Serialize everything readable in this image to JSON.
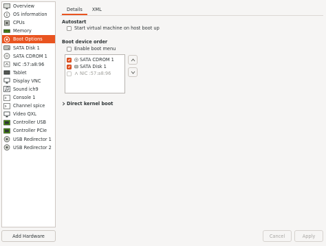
{
  "sidebar": {
    "items": [
      {
        "label": "Overview",
        "icon": "monitor-icon"
      },
      {
        "label": "OS information",
        "icon": "info-icon"
      },
      {
        "label": "CPUs",
        "icon": "cpu-icon"
      },
      {
        "label": "Memory",
        "icon": "memory-icon"
      },
      {
        "label": "Boot Options",
        "icon": "boot-gear-icon"
      },
      {
        "label": "SATA Disk 1",
        "icon": "disk-icon"
      },
      {
        "label": "SATA CDROM 1",
        "icon": "cdrom-icon"
      },
      {
        "label": "NIC :57:a8:96",
        "icon": "nic-icon"
      },
      {
        "label": "Tablet",
        "icon": "tablet-icon"
      },
      {
        "label": "Display VNC",
        "icon": "display-icon"
      },
      {
        "label": "Sound ich9",
        "icon": "sound-icon"
      },
      {
        "label": "Console 1",
        "icon": "console-icon"
      },
      {
        "label": "Channel spice",
        "icon": "channel-icon"
      },
      {
        "label": "Video QXL",
        "icon": "video-icon"
      },
      {
        "label": "Controller USB",
        "icon": "controller-icon"
      },
      {
        "label": "Controller PCIe",
        "icon": "controller-icon"
      },
      {
        "label": "USB Redirector 1",
        "icon": "usb-redirector-icon"
      },
      {
        "label": "USB Redirector 2",
        "icon": "usb-redirector-icon"
      }
    ],
    "selected_index": 4,
    "add_hardware_label": "Add Hardware"
  },
  "tabs": [
    {
      "label": "Details",
      "active": true
    },
    {
      "label": "XML",
      "active": false
    }
  ],
  "autostart": {
    "heading": "Autostart",
    "checkbox_label": "Start virtual machine on host boot up",
    "checked": false
  },
  "boot_order": {
    "heading": "Boot device order",
    "enable_menu_label": "Enable boot menu",
    "enable_menu_checked": false,
    "devices": [
      {
        "label": "SATA CDROM 1",
        "checked": true,
        "enabled": true,
        "icon": "cdrom-icon"
      },
      {
        "label": "SATA Disk 1",
        "checked": true,
        "enabled": true,
        "icon": "disk-icon"
      },
      {
        "label": "NIC :57:a8:96",
        "checked": false,
        "enabled": false,
        "icon": "nic-icon"
      }
    ],
    "move_up_icon": "chevron-up-icon",
    "move_down_icon": "chevron-down-icon"
  },
  "direct_kernel": {
    "label": "Direct kernel boot",
    "expanded": false
  },
  "buttons": {
    "cancel": "Cancel",
    "apply": "Apply"
  },
  "colors": {
    "accent": "#e95420",
    "background": "#f6f5f4"
  }
}
